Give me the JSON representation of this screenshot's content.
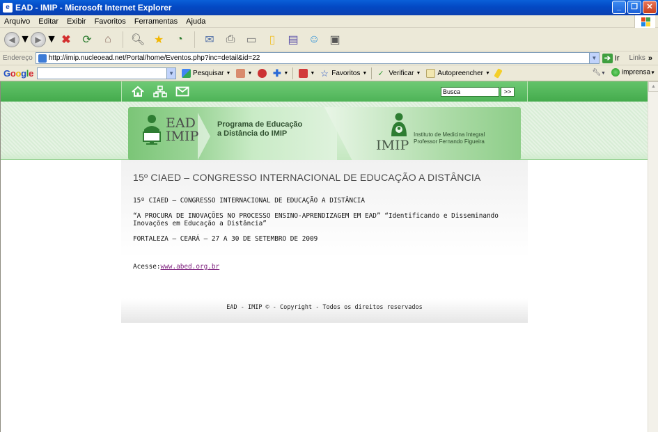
{
  "window": {
    "title": "EAD - IMIP - Microsoft Internet Explorer",
    "controls": [
      "_",
      "❐",
      "✕"
    ]
  },
  "menu": [
    "Arquivo",
    "Editar",
    "Exibir",
    "Favoritos",
    "Ferramentas",
    "Ajuda"
  ],
  "address": {
    "label": "Endereço",
    "url": "http://imip.nucleoead.net/Portal/home/Eventos.php?inc=detail&id=22",
    "go_label": "Ir",
    "links_label": "Links"
  },
  "google_bar": {
    "search_placeholder": "",
    "pesquisar": "Pesquisar",
    "favoritos": "Favoritos",
    "verificar": "Verificar",
    "autopreencher": "Autopreencher",
    "imprensa": "imprensa"
  },
  "site": {
    "search_value": "Busca",
    "search_button": ">>",
    "banner": {
      "ead_line1": "EAD",
      "ead_line2": "IMIP",
      "program_line1": "Programa de Educação",
      "program_line2": "a Distância do IMIP",
      "imip": "IMIP",
      "institute_line1": "Instituto de Medicina Integral",
      "institute_line2": "Professor Fernando Figueira"
    },
    "page_title": "15º CIAED – CONGRESSO INTERNACIONAL DE EDUCAÇÃO A DISTÂNCIA",
    "body": {
      "p1": "15º CIAED – CONGRESSO INTERNACIONAL DE EDUCAÇÃO A DISTÂNCIA",
      "p2": "“A PROCURA DE INOVAÇÕES NO PROCESSO ENSINO-APRENDIZAGEM EM EAD” “Identificando e Disseminando Inovações em Educação a Distância”",
      "p3": "FORTALEZA – CEARÁ – 27 A 30 DE SETEMBRO DE 2009",
      "access_label": "Acesse:",
      "access_link": "www.abed.org.br"
    },
    "footer": "EAD - IMIP © - Copyright - Todos os direitos reservados"
  }
}
